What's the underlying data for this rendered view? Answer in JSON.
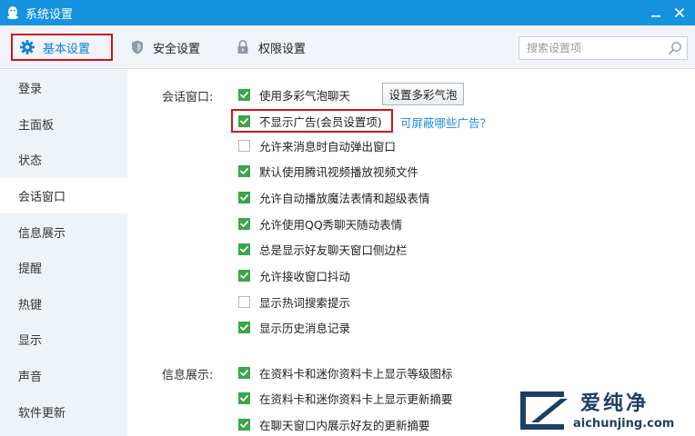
{
  "window": {
    "title": "系统设置",
    "accent": "#1693df"
  },
  "toolbar": {
    "tabs": [
      {
        "label": "基本设置",
        "icon": "gear-icon",
        "active": true
      },
      {
        "label": "安全设置",
        "icon": "shield-icon"
      },
      {
        "label": "权限设置",
        "icon": "lock-icon"
      }
    ]
  },
  "search": {
    "placeholder": "搜索设置项"
  },
  "sidebar": {
    "items": [
      {
        "label": "登录"
      },
      {
        "label": "主面板"
      },
      {
        "label": "状态"
      },
      {
        "label": "会话窗口",
        "active": true
      },
      {
        "label": "信息展示"
      },
      {
        "label": "提醒"
      },
      {
        "label": "热键"
      },
      {
        "label": "显示"
      },
      {
        "label": "声音"
      },
      {
        "label": "软件更新"
      }
    ]
  },
  "session_window": {
    "label": "会话窗口:",
    "bubble_button": "设置多彩气泡",
    "ad_link": "可屏蔽哪些广告？",
    "options": [
      {
        "label": "使用多彩气泡聊天",
        "checked": true
      },
      {
        "label": "不显示广告(会员设置项)",
        "checked": true
      },
      {
        "label": "允许来消息时自动弹出窗口",
        "checked": false
      },
      {
        "label": "默认使用腾讯视频播放视频文件",
        "checked": true
      },
      {
        "label": "允许自动播放魔法表情和超级表情",
        "checked": true
      },
      {
        "label": "允许使用QQ秀聊天随动表情",
        "checked": true
      },
      {
        "label": "总是显示好友聊天窗口侧边栏",
        "checked": true
      },
      {
        "label": "允许接收窗口抖动",
        "checked": true
      },
      {
        "label": "显示热词搜索提示",
        "checked": false
      },
      {
        "label": "显示历史消息记录",
        "checked": true
      }
    ]
  },
  "info_display": {
    "label": "信息展示:",
    "options": [
      {
        "label": "在资料卡和迷你资料卡上显示等级图标",
        "checked": true
      },
      {
        "label": "在资料卡和迷你资料卡上显示更新摘要",
        "checked": true
      },
      {
        "label": "在聊天窗口内展示好友的更新摘要",
        "checked": true
      }
    ]
  },
  "watermark": {
    "name": "爱纯净",
    "url": "aichunjing.com"
  }
}
